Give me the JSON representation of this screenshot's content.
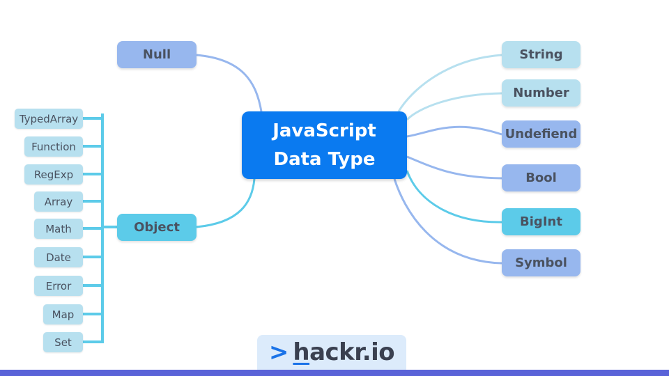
{
  "diagram": {
    "central": {
      "line1": "JavaScript",
      "line2": "Data Type"
    },
    "nodes": {
      "null": "Null",
      "object": "Object",
      "string": "String",
      "number": "Number",
      "undefiend": "Undefiend",
      "bool": "Bool",
      "bigint": "BigInt",
      "symbol": "Symbol"
    },
    "object_children": [
      "TypedArray",
      "Function",
      "RegExp",
      "Array",
      "Math",
      "Date",
      "Error",
      "Map",
      "Set"
    ]
  },
  "colors": {
    "central": "#0a7af0",
    "light_blue": "#b7e0ef",
    "periwinkle": "#97b7ee",
    "cyan": "#5ccbe9",
    "bracket": "#5ccbe9",
    "footer": "#5a63d8"
  },
  "logo": {
    "chevron": ">",
    "h": "h",
    "rest": "ackr.io"
  }
}
